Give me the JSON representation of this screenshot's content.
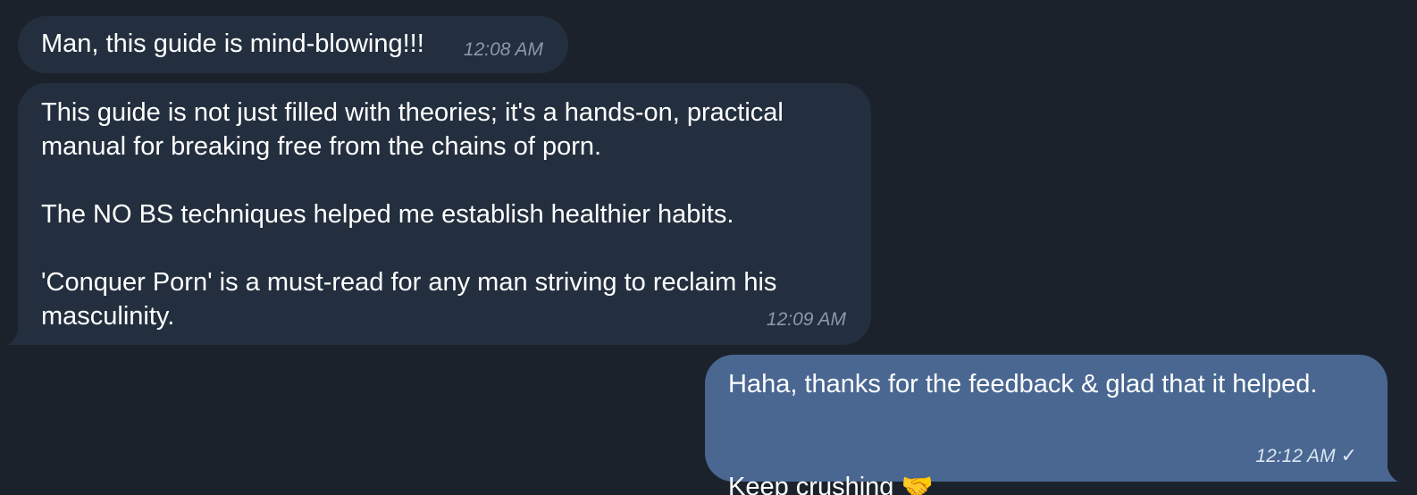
{
  "messages": [
    {
      "direction": "incoming",
      "text": "Man, this guide is mind-blowing!!!",
      "time": "12:08 AM"
    },
    {
      "direction": "incoming",
      "text": "This guide is not just filled with theories; it's a hands-on, practical\nmanual for breaking free from the chains of porn.\n\nThe NO BS techniques helped me establish healthier habits.\n\n'Conquer Porn' is a must-read for any man striving to reclaim his\nmasculinity.",
      "time": "12:09 AM"
    },
    {
      "direction": "outgoing",
      "text_line1": "Haha, thanks for the feedback & glad that it helped.",
      "text_line2": "Keep crushing",
      "emoji": "🤝",
      "time": "12:12 AM",
      "status": "✓"
    }
  ],
  "colors": {
    "background": "#1c222b",
    "incoming_bubble": "#232f3e",
    "outgoing_bubble": "#496791",
    "timestamp_incoming": "#8b99aa",
    "text": "#ffffff"
  }
}
